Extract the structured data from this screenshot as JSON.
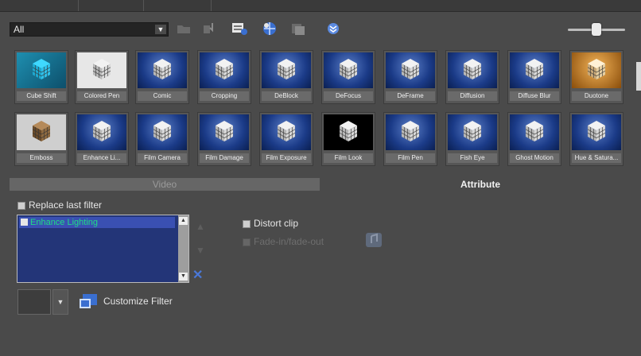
{
  "toolbar": {
    "category_value": "All",
    "icons": [
      "folder-icon",
      "import-icon",
      "filter-list-icon",
      "globe-icon",
      "gallery-icon",
      "expand-icon"
    ]
  },
  "effects": {
    "row1": [
      "Cube Shift",
      "Colored Pen",
      "Comic",
      "Cropping",
      "DeBlock",
      "DeFocus",
      "DeFrame",
      "Diffusion",
      "Diffuse Blur",
      "Duotone"
    ],
    "row2": [
      "Emboss",
      "Enhance Li...",
      "Film Camera",
      "Film Damage",
      "Film Exposure",
      "Film Look",
      "Film Pen",
      "Fish Eye",
      "Ghost Motion",
      "Hue & Satura..."
    ]
  },
  "tabs": {
    "video": "Video",
    "attribute": "Attribute"
  },
  "attribute": {
    "replace_last_filter": "Replace last filter",
    "filter_list": [
      "Enhance Lighting"
    ],
    "distort_clip": "Distort clip",
    "fade_effect": "Fade-in/fade-out",
    "customize_filter": "Customize Filter"
  },
  "colors": {
    "accent_blue": "#233578",
    "selected_text": "#1fdc86"
  }
}
